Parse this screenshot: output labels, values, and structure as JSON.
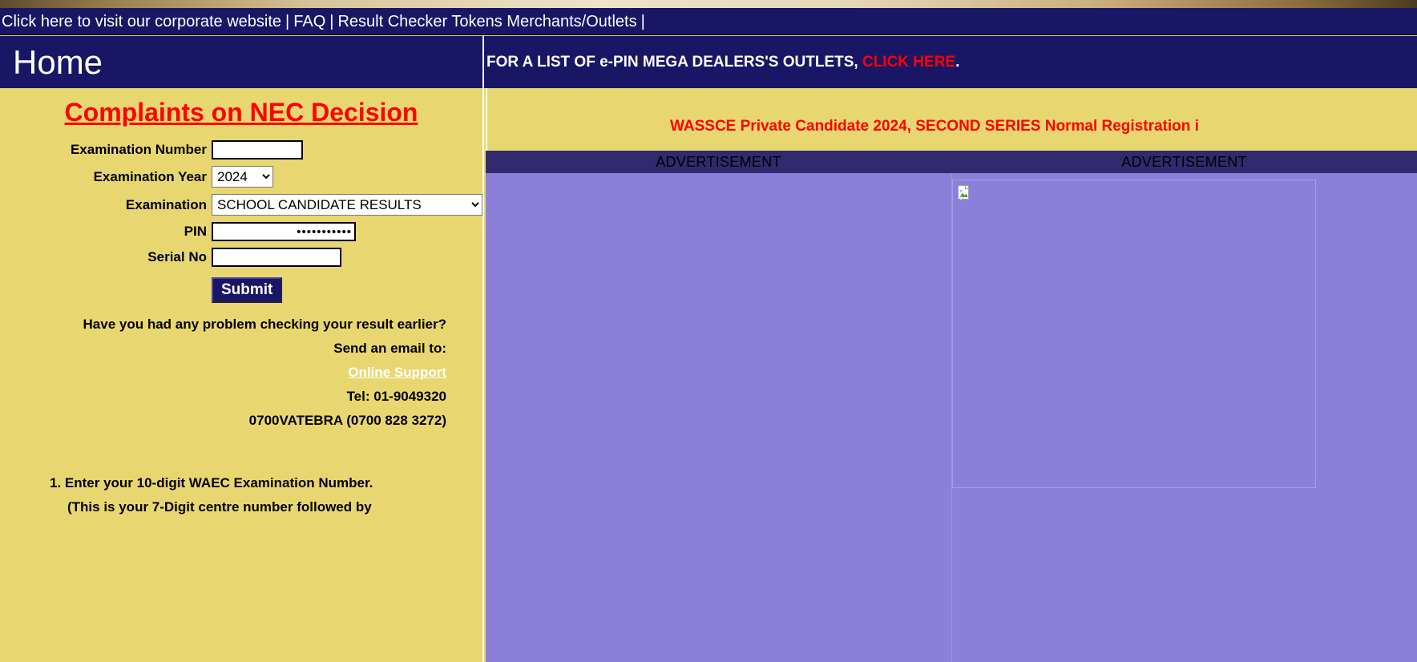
{
  "navbar": {
    "corporate_link": "Click here to visit our corporate website",
    "sep1": "|",
    "faq_link": "FAQ",
    "sep2": "|",
    "tokens_link": "Result Checker Tokens Merchants/Outlets",
    "sep3": "|"
  },
  "header": {
    "home_title": "Home",
    "dealer_prefix": "FOR A LIST OF e-PIN MEGA DEALERS'S OUTLETS, ",
    "dealer_link": "CLICK HERE",
    "dealer_suffix": "."
  },
  "left": {
    "complaints_heading": "Complaints on NEC Decision",
    "form": {
      "exam_number_label": "Examination Number",
      "exam_number_value": "",
      "exam_number_placeholder": "",
      "exam_year_label": "Examination Year",
      "exam_year_value": "2024",
      "exam_year_options": [
        "2024"
      ],
      "examination_label": "Examination",
      "examination_value": "SCHOOL CANDIDATE RESULTS",
      "examination_options": [
        "SCHOOL CANDIDATE RESULTS"
      ],
      "pin_label": "PIN",
      "pin_value": "•••••••••••",
      "serial_label": "Serial No",
      "serial_value": "",
      "submit_label": "Submit"
    },
    "support": {
      "problem_line": "Have you had any problem checking your result earlier?",
      "email_line": "Send an email to:",
      "online_support_link": "Online Support",
      "tel_line": "Tel: 01-9049320",
      "vatebra_line": "0700VATEBRA (0700 828 3272)"
    },
    "instructions": [
      "1. Enter your 10-digit WAEC Examination Number.",
      "(This is your 7-Digit centre number followed by"
    ]
  },
  "right": {
    "marquee_text": "WASSCE Private Candidate 2024, SECOND SERIES Normal Registration i",
    "ad_header_left": "ADVERTISEMENT",
    "ad_header_right": "ADVERTISEMENT",
    "broken_image_alt": "broken-image"
  },
  "colors": {
    "navy": "#1a1666",
    "khaki": "#e8d671",
    "red": "#ff0000",
    "ad_purple": "#8b80d9",
    "ad_header": "#312a6e"
  }
}
